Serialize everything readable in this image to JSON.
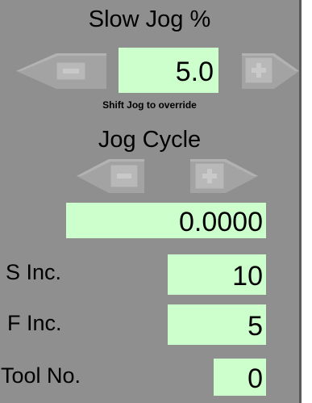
{
  "slow_jog": {
    "title": "Slow Jog %",
    "value": "5.0",
    "minus_icon": "minus-arrow-left-icon",
    "plus_icon": "plus-arrow-right-icon",
    "hint": "Shift Jog to override"
  },
  "jog_cycle": {
    "title": "Jog Cycle",
    "value": "0.0000",
    "minus_icon": "minus-arrow-left-icon",
    "plus_icon": "plus-arrow-right-icon"
  },
  "s_inc": {
    "label": "S Inc.",
    "value": "10"
  },
  "f_inc": {
    "label": "F Inc.",
    "value": "5"
  },
  "tool_no": {
    "label": "Tool No.",
    "value": "0"
  },
  "colors": {
    "background": "#8f8f8f",
    "field": "#ccffcc",
    "arrow": "#9e9e9e",
    "arrow_highlight": "#b4b4b4",
    "sidebar": "#ffffff"
  }
}
